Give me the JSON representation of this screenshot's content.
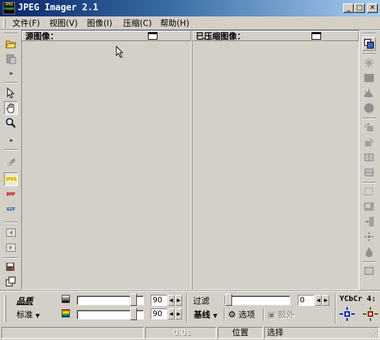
{
  "window": {
    "title": "JPEG Imager 2.1",
    "icon_text_1": "JPEG",
    "icon_text_2": "imager"
  },
  "caption_buttons": {
    "minimize": "_",
    "maximize": "□",
    "close": "✕"
  },
  "menu": [
    "文件(F)",
    "视图(V)",
    "图像(I)",
    "压缩(C)",
    "帮助(H)"
  ],
  "panes": {
    "source_title": "源图像：",
    "compressed_title": "已压缩图像："
  },
  "left_toolbar": {
    "chevron": "»",
    "format_badges": [
      "JPEG",
      "BMP",
      "GIF"
    ]
  },
  "controls": {
    "quality_label": "品质",
    "preset_label": "标准",
    "quality_value_1": "90",
    "quality_value_2": "90",
    "quality_level_1": 0.9,
    "quality_level_2": 0.9,
    "filter_label": "过滤",
    "filter_value": "0",
    "filter_level": 0.0,
    "baseline_label": "基线",
    "options_label": "选项",
    "extra_label": "额外",
    "colorspace_label": "YCbCr 4:"
  },
  "status": {
    "time": "0.0s",
    "position_label": "位置",
    "selection_label": "选择"
  },
  "colors": {
    "title_start": "#0a246a",
    "title_end": "#a6caf0",
    "face": "#d4d0c8"
  }
}
